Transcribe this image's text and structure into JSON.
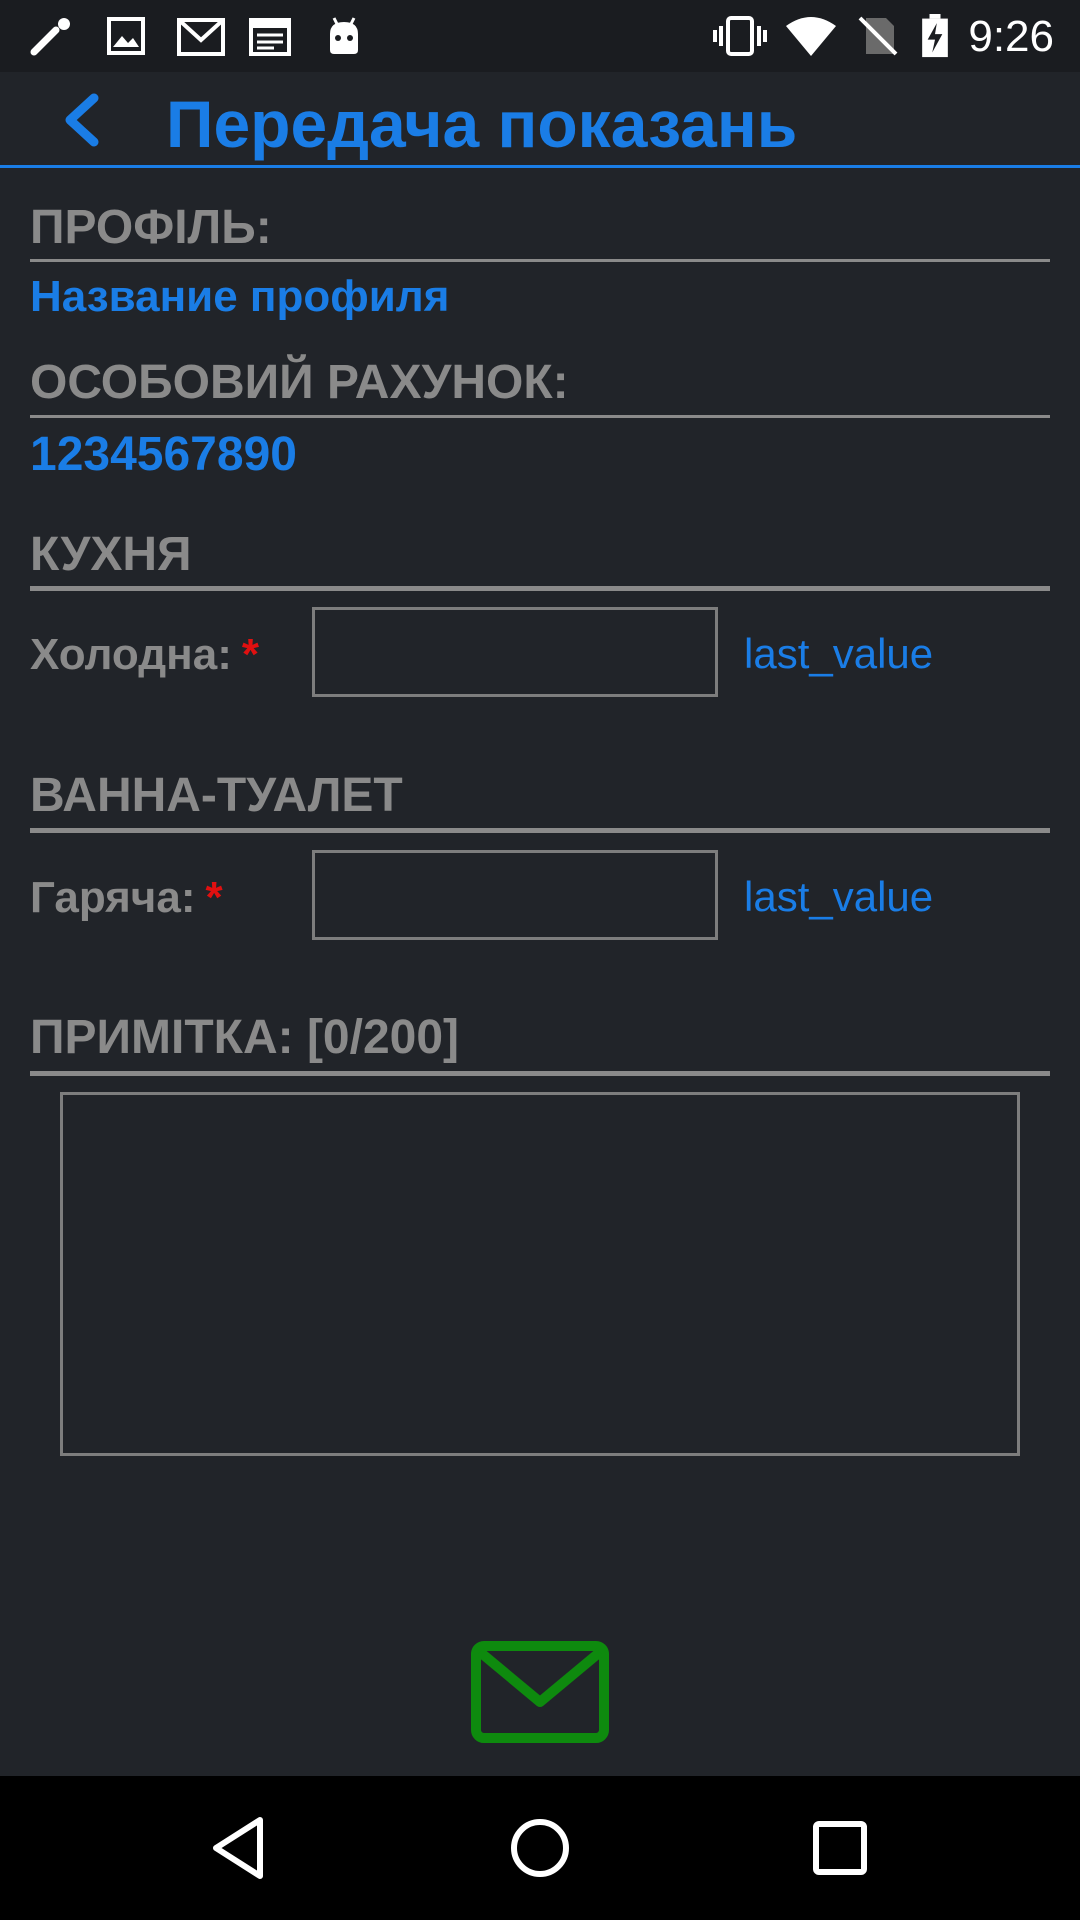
{
  "status_bar": {
    "time": "9:26",
    "icons_left": [
      "wrench-icon",
      "image-icon",
      "gmail-icon",
      "calendar-icon",
      "android-icon"
    ],
    "icons_right": [
      "vibrate-icon",
      "wifi-icon",
      "no-signal-icon",
      "battery-charging-icon"
    ]
  },
  "app_bar": {
    "title": "Передача показань",
    "back_icon": "chevron-left-icon"
  },
  "profile": {
    "label": "ПРОФІЛЬ:",
    "value": "Название профиля"
  },
  "account": {
    "label": "ОСОБОВИЙ РАХУНОК:",
    "value": "1234567890"
  },
  "sections": [
    {
      "title": "КУХНЯ",
      "field_label": "Холодна:",
      "required_mark": "*",
      "input_value": "",
      "last_value": "last_value"
    },
    {
      "title": "ВАННА-ТУАЛЕТ",
      "field_label": "Гаряча:",
      "required_mark": "*",
      "input_value": "",
      "last_value": "last_value"
    }
  ],
  "note": {
    "label": "ПРИМІТКА: [0/200]",
    "value": ""
  },
  "send_button": {
    "icon": "envelope-icon",
    "color": "#0e8a0e"
  },
  "nav_bar": {
    "buttons": [
      "back-triangle-icon",
      "home-circle-icon",
      "recents-square-icon"
    ]
  },
  "colors": {
    "background": "#212429",
    "accent": "#1a7de6",
    "label": "#8a8a8a",
    "required": "#e01010",
    "send": "#0e8a0e"
  }
}
